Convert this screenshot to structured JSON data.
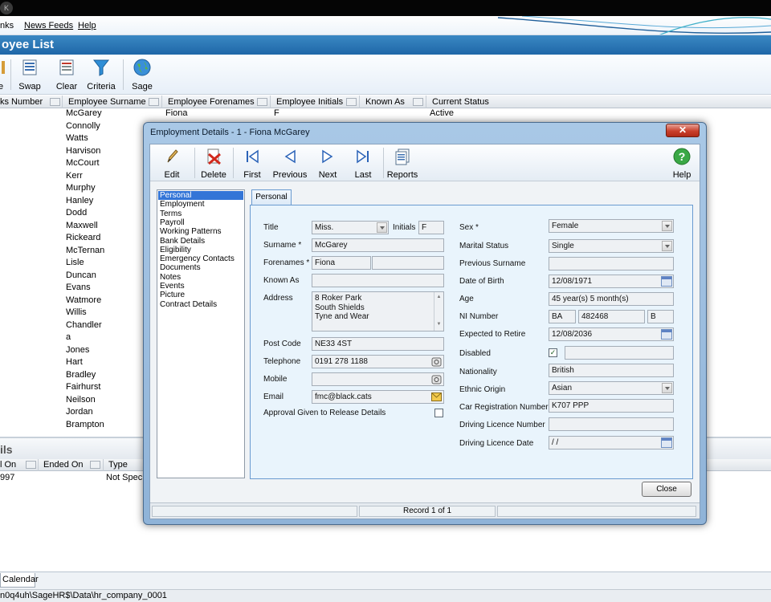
{
  "menu": {
    "items": [
      "nks",
      "News Feeds",
      "Help"
    ]
  },
  "app_header": {
    "title": "oyee List"
  },
  "toolbar": {
    "buttons": [
      {
        "label": "e",
        "icon": "edit-icon"
      },
      {
        "label": "Swap",
        "icon": "swap-icon"
      },
      {
        "label": "Clear",
        "icon": "clear-icon"
      },
      {
        "label": "Criteria",
        "icon": "funnel-icon"
      },
      {
        "label": "Sage",
        "icon": "globe-icon"
      }
    ]
  },
  "grid": {
    "columns": [
      "ks Number",
      "Employee Surname",
      "Employee Forenames",
      "Employee Initials",
      "Known As",
      "Current Status"
    ],
    "first_row": {
      "surname": "McGarey",
      "forenames": "Fiona",
      "initials": "F",
      "status": "Active"
    },
    "surnames": [
      "Connolly",
      "Watts",
      "Harvison",
      "McCourt",
      "Kerr",
      "Murphy",
      "Hanley",
      "Dodd",
      "Maxwell",
      "Rickeard",
      "McTernan",
      "Lisle",
      "Duncan",
      "Evans",
      "Watmore",
      "Willis",
      "Chandler",
      "a",
      "Jones",
      "Hart",
      "Bradley",
      "Fairhurst",
      "Neilson",
      "Jordan",
      "Brampton"
    ]
  },
  "details": {
    "title": "ils",
    "columns": [
      "l On",
      "Ended On",
      "Type"
    ],
    "row": {
      "started": "997",
      "type": "Not Specifi"
    }
  },
  "bottom": {
    "tab_calendar": "Calendar",
    "status_path": "n0q4uh\\SageHR$\\Data\\hr_company_0001"
  },
  "dialog": {
    "title": "Employment Details - 1 - Fiona McGarey",
    "close_glyph": "✕",
    "toolbar": {
      "edit": "Edit",
      "delete": "Delete",
      "first": "First",
      "previous": "Previous",
      "next": "Next",
      "last": "Last",
      "reports": "Reports",
      "help": "Help"
    },
    "nav": [
      "Personal",
      "Employment",
      "Terms",
      "Payroll",
      "Working Patterns",
      "Bank Details",
      "Eligibility",
      "Emergency Contacts",
      "Documents",
      "Notes",
      "Events",
      "Picture",
      "Contract Details"
    ],
    "tab": "Personal",
    "labels": {
      "title": "Title",
      "initials": "Initials",
      "surname": "Surname *",
      "forenames": "Forenames *",
      "known_as": "Known As",
      "address": "Address",
      "post_code": "Post Code",
      "telephone": "Telephone",
      "mobile": "Mobile",
      "email": "Email",
      "approval": "Approval Given to Release Details",
      "sex": "Sex *",
      "marital": "Marital Status",
      "prev_surname": "Previous Surname",
      "dob": "Date of Birth",
      "age": "Age",
      "ni": "NI Number",
      "retire": "Expected to Retire",
      "disabled": "Disabled",
      "nationality": "Nationality",
      "ethnic": "Ethnic Origin",
      "car_reg": "Car Registration Number",
      "licence_no": "Driving Licence Number",
      "licence_date": "Driving Licence Date"
    },
    "values": {
      "title": "Miss.",
      "initials": "F",
      "surname": "McGarey",
      "forename1": "Fiona",
      "forename2": "",
      "known_as": "",
      "address1": "8 Roker Park",
      "address2": "South Shields",
      "address3": "Tyne and Wear",
      "post_code": "NE33 4ST",
      "telephone": "0191 278 1188",
      "mobile": "",
      "email": "fmc@black.cats",
      "approval_checked": false,
      "sex": "Female",
      "marital": "Single",
      "prev_surname": "",
      "dob": "12/08/1971",
      "age": "45 year(s) 5 month(s)",
      "ni1": "BA",
      "ni2": "482468",
      "ni3": "B",
      "retire": "12/08/2036",
      "disabled_checked": true,
      "disabled_text": "",
      "nationality": "British",
      "ethnic": "Asian",
      "car_reg": "K707 PPP",
      "licence_no": "",
      "licence_date": " / /"
    },
    "close_button": "Close",
    "status": {
      "record": "Record 1 of 1"
    }
  }
}
